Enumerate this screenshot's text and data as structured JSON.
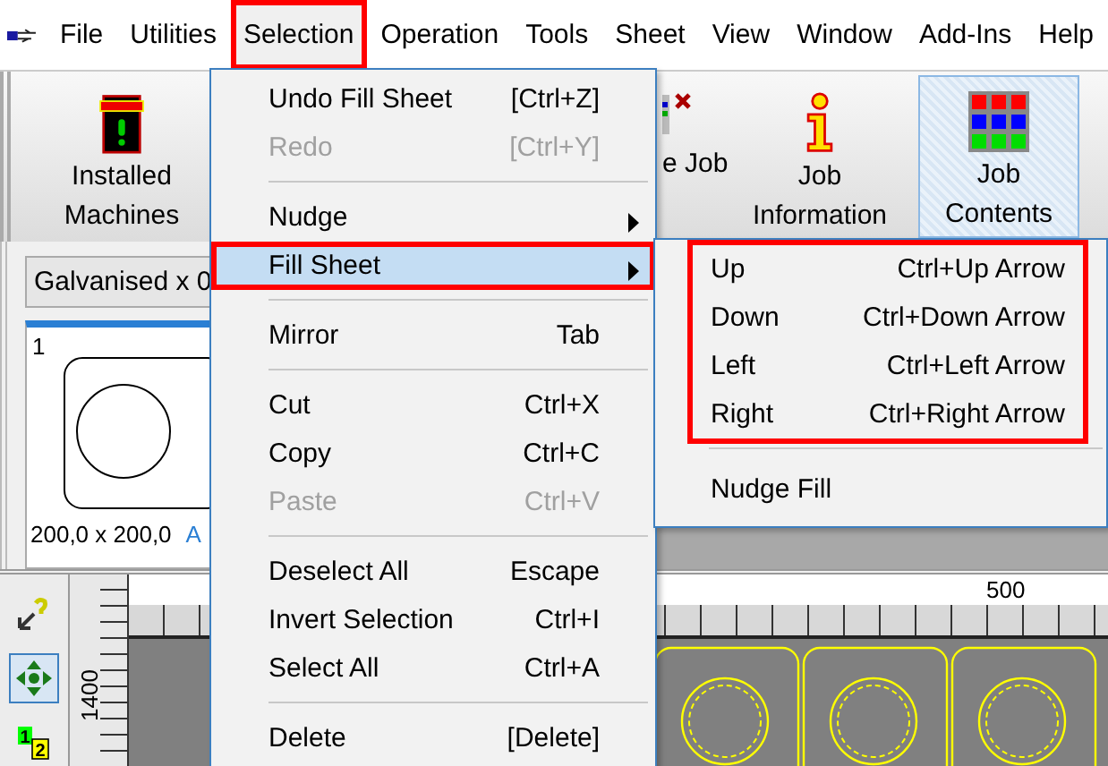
{
  "menu_bar": {
    "items": [
      {
        "label": "File",
        "selected": false,
        "annotated": false
      },
      {
        "label": "Utilities",
        "selected": false,
        "annotated": false
      },
      {
        "label": "Selection",
        "selected": true,
        "annotated": true
      },
      {
        "label": "Operation",
        "selected": false,
        "annotated": false
      },
      {
        "label": "Tools",
        "selected": false,
        "annotated": false
      },
      {
        "label": "Sheet",
        "selected": false,
        "annotated": false
      },
      {
        "label": "View",
        "selected": false,
        "annotated": false
      },
      {
        "label": "Window",
        "selected": false,
        "annotated": false
      },
      {
        "label": "Add-Ins",
        "selected": false,
        "annotated": false
      },
      {
        "label": "Help",
        "selected": false,
        "annotated": false
      }
    ]
  },
  "toolbar": {
    "buttons": [
      {
        "kind": "machines",
        "label_lines": [
          "Installed",
          "Machines"
        ],
        "selected": false
      },
      {
        "kind": "job",
        "label_lines": [
          "e Job"
        ],
        "selected": false
      },
      {
        "kind": "info",
        "label_lines": [
          "Job",
          "Information"
        ],
        "selected": false
      },
      {
        "kind": "contents",
        "label_lines": [
          "Job",
          "Contents"
        ],
        "selected": true
      }
    ]
  },
  "material_select": {
    "value": "Galvanised x 0"
  },
  "part_card": {
    "number": "1",
    "size": "200,0 x 200,0",
    "extra": "A"
  },
  "tool_strip": [
    {
      "kind": "help",
      "selected": false
    },
    {
      "kind": "move",
      "selected": true
    },
    {
      "kind": "sequence",
      "labels": [
        "1",
        "2"
      ],
      "selected": false
    }
  ],
  "rulers": {
    "vertical_label": "1400",
    "horizontal_label": "500"
  },
  "selection_menu": {
    "items": [
      {
        "kind": "item",
        "label": "Undo Fill Sheet",
        "shortcut": "[Ctrl+Z]",
        "disabled": false,
        "highlighted": false,
        "annotated": false,
        "has_submenu": false
      },
      {
        "kind": "item",
        "label": "Redo",
        "shortcut": "[Ctrl+Y]",
        "disabled": true,
        "highlighted": false,
        "annotated": false,
        "has_submenu": false
      },
      {
        "kind": "separator"
      },
      {
        "kind": "item",
        "label": "Nudge",
        "disabled": false,
        "highlighted": false,
        "annotated": false,
        "has_submenu": true
      },
      {
        "kind": "item",
        "label": "Fill Sheet",
        "disabled": false,
        "highlighted": true,
        "annotated": true,
        "has_submenu": true
      },
      {
        "kind": "separator"
      },
      {
        "kind": "item",
        "label": "Mirror",
        "shortcut": "Tab",
        "disabled": false,
        "highlighted": false,
        "annotated": false,
        "has_submenu": false
      },
      {
        "kind": "separator"
      },
      {
        "kind": "item",
        "label": "Cut",
        "shortcut": "Ctrl+X",
        "disabled": false,
        "highlighted": false,
        "annotated": false,
        "has_submenu": false
      },
      {
        "kind": "item",
        "label": "Copy",
        "shortcut": "Ctrl+C",
        "disabled": false,
        "highlighted": false,
        "annotated": false,
        "has_submenu": false
      },
      {
        "kind": "item",
        "label": "Paste",
        "shortcut": "Ctrl+V",
        "disabled": true,
        "highlighted": false,
        "annotated": false,
        "has_submenu": false
      },
      {
        "kind": "separator"
      },
      {
        "kind": "item",
        "label": "Deselect All",
        "shortcut": "Escape",
        "disabled": false,
        "highlighted": false,
        "annotated": false,
        "has_submenu": false
      },
      {
        "kind": "item",
        "label": "Invert Selection",
        "shortcut": "Ctrl+I",
        "disabled": false,
        "highlighted": false,
        "annotated": false,
        "has_submenu": false
      },
      {
        "kind": "item",
        "label": "Select All",
        "shortcut": "Ctrl+A",
        "disabled": false,
        "highlighted": false,
        "annotated": false,
        "has_submenu": false
      },
      {
        "kind": "separator"
      },
      {
        "kind": "item",
        "label": "Delete",
        "shortcut": "[Delete]",
        "disabled": false,
        "highlighted": false,
        "annotated": false,
        "has_submenu": false
      }
    ]
  },
  "fill_sheet_submenu": {
    "groups": [
      {
        "annotated": true,
        "items": [
          {
            "label": "Up",
            "shortcut": "Ctrl+Up Arrow"
          },
          {
            "label": "Down",
            "shortcut": "Ctrl+Down Arrow"
          },
          {
            "label": "Left",
            "shortcut": "Ctrl+Left Arrow"
          },
          {
            "label": "Right",
            "shortcut": "Ctrl+Right Arrow"
          }
        ]
      },
      {
        "annotated": false,
        "items": [
          {
            "label": "Nudge Fill"
          }
        ]
      }
    ]
  }
}
